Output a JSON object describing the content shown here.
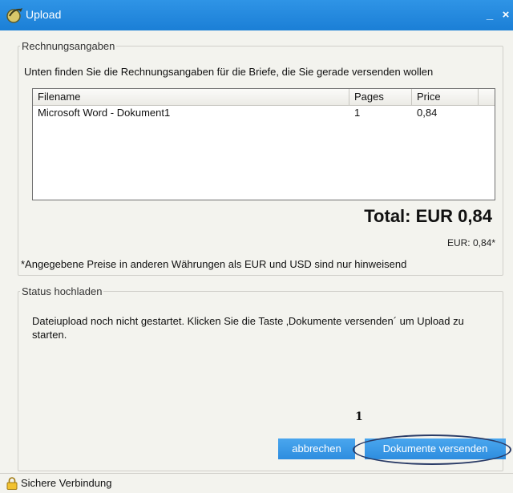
{
  "window": {
    "title": "Upload",
    "minimize_glyph": "_",
    "close_glyph": "×"
  },
  "invoice": {
    "legend": "Rechnungsangaben",
    "description": "Unten finden Sie die Rechnungsangaben für die Briefe, die Sie gerade versenden wollen",
    "table": {
      "headers": [
        "Filename",
        "Pages",
        "Price"
      ],
      "rows": [
        {
          "filename": "Microsoft Word - Dokument1",
          "pages": "1",
          "price": "0,84"
        }
      ]
    },
    "total": "Total: EUR 0,84",
    "eur_amount": "EUR: 0,84*",
    "footnote": "*Angegebene Preise in anderen Währungen als EUR und USD sind nur hinweisend"
  },
  "status": {
    "legend": "Status hochladen",
    "message": "Dateiupload noch nicht gestartet. Klicken Sie die Taste ‚Dokumente versenden´ um Upload zu starten."
  },
  "annotation": {
    "label": "1"
  },
  "buttons": {
    "cancel": "abbrechen",
    "send": "Dokumente versenden"
  },
  "statusbar": {
    "label": "Sichere Verbindung",
    "icon": "lock-icon"
  },
  "colors": {
    "titlebar": "#1b7fd6",
    "button": "#2d8ddf",
    "annotation_ring": "#2a3b66"
  }
}
